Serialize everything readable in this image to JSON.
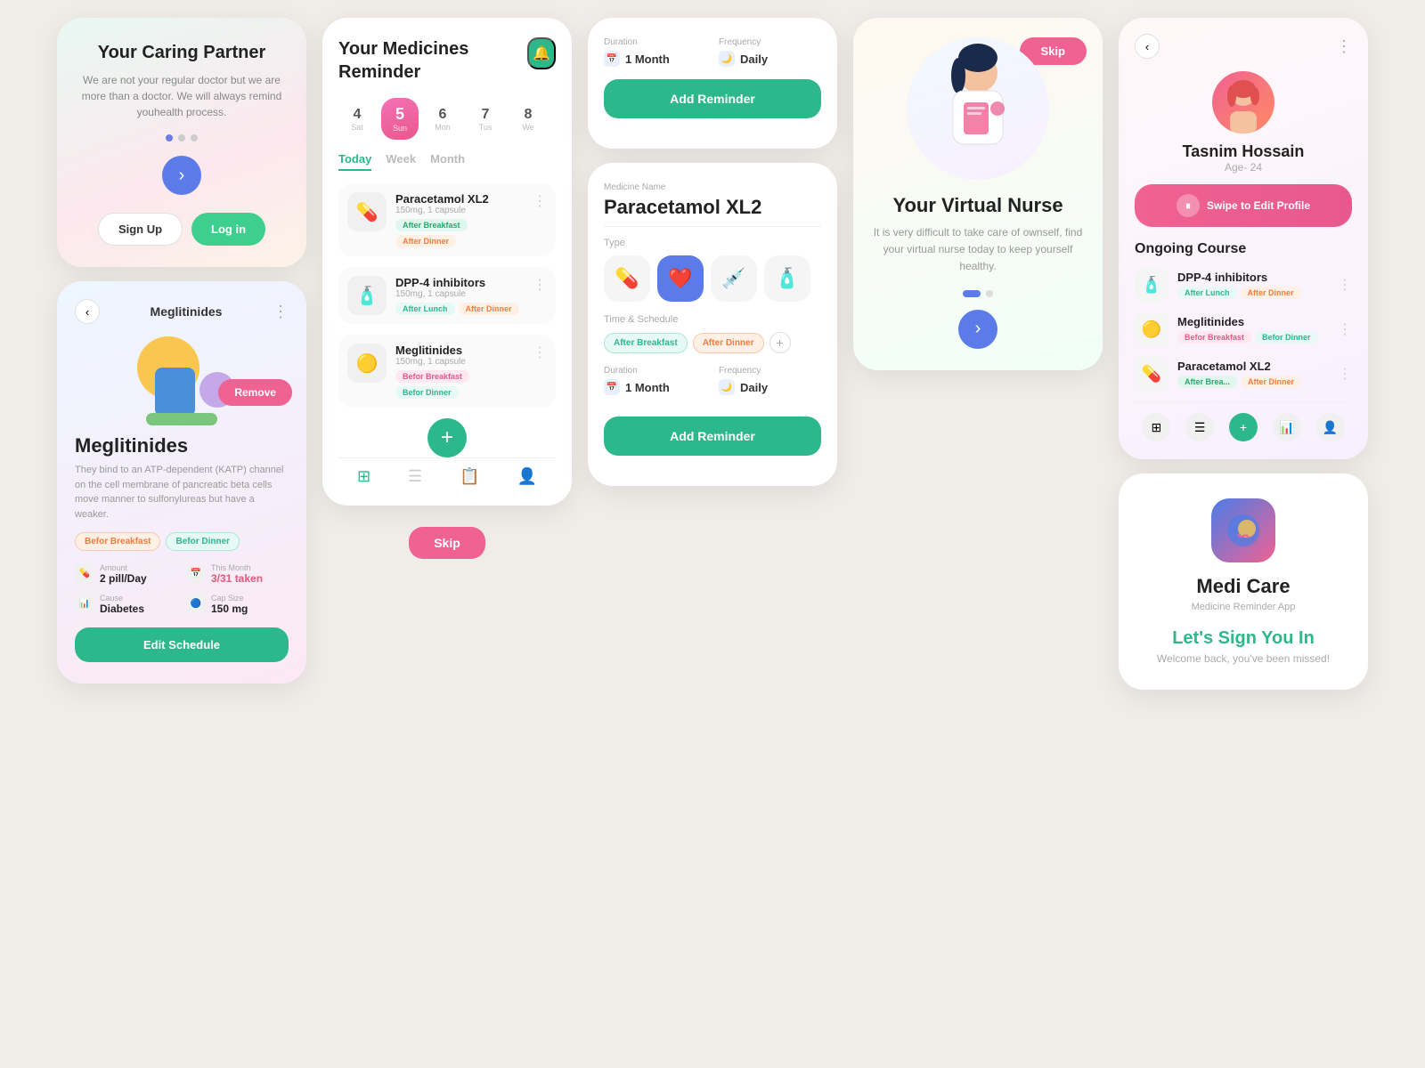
{
  "panel1": {
    "caring": {
      "title": "Your Caring Partner",
      "subtitle": "We are not your regular doctor but we are more than a doctor. We will always remind youhealth process.",
      "signup_label": "Sign Up",
      "login_label": "Log in"
    },
    "megli": {
      "back_label": "‹",
      "title": "Meglitinides",
      "more_label": "⋮",
      "remove_label": "Remove",
      "name": "Meglitinides",
      "desc": "They bind to an ATP-dependent (KATP) channel on the cell membrane of pancreatic beta cells move manner to sulfonylureas but have a weaker.",
      "tag1": "Befor Breakfast",
      "tag2": "Befor Dinner",
      "amount_label": "Amount",
      "amount_value": "2 pill/Day",
      "this_month_label": "This Month",
      "this_month_value": "3/31 taken",
      "cause_label": "Cause",
      "cause_value": "Diabetes",
      "cap_size_label": "Cap Size",
      "cap_size_value": "150 mg",
      "edit_label": "Edit Schedule"
    }
  },
  "panel2": {
    "reminder": {
      "title": "Your Medicines Reminder",
      "bell_icon": "🔔",
      "dates": [
        {
          "day": "4",
          "name": "Sat",
          "active": false
        },
        {
          "day": "5",
          "name": "Sun",
          "active": true
        },
        {
          "day": "6",
          "name": "Mon",
          "active": false
        },
        {
          "day": "7",
          "name": "Tus",
          "active": false
        },
        {
          "day": "8",
          "name": "We",
          "active": false
        }
      ],
      "tabs": [
        "Today",
        "Week",
        "Month"
      ],
      "active_tab": "Today",
      "medicines": [
        {
          "name": "Paracetamol XL2",
          "dose": "150mg, 1 capsule",
          "tags": [
            "After Breakfast",
            "After Dinner"
          ],
          "icon": "💊"
        },
        {
          "name": "DPP-4 inhibitors",
          "dose": "150mg, 1 capsule",
          "tags": [
            "After Lunch",
            "After Dinner"
          ],
          "icon": "🧴"
        },
        {
          "name": "Meglitinides",
          "dose": "150mg, 1 capsule",
          "tags": [
            "Befor Breakfast",
            "Befor Dinner"
          ],
          "icon": "🟡"
        }
      ],
      "skip_label": "Skip"
    }
  },
  "panel3": {
    "add_reminder": {
      "duration_label": "Duration",
      "duration_value": "1 Month",
      "frequency_label": "Frequency",
      "frequency_value": "Daily",
      "add_btn_label": "Add Reminder",
      "medicine_name_label": "Medicine Name",
      "medicine_name": "Paracetamol XL2",
      "type_label": "Type",
      "time_schedule_label": "Time & Schedule",
      "time_tags": [
        "After Breakfast",
        "After Dinner"
      ],
      "duration2_label": "Duration",
      "duration2_value": "1 Month",
      "frequency2_label": "Frequency",
      "frequency2_value": "Daily",
      "add_btn2_label": "Add Reminder"
    },
    "breakfast": {
      "label": "Breakfast"
    }
  },
  "panel4": {
    "virtual_nurse": {
      "skip_label": "Skip",
      "title": "Your Virtual Nurse",
      "subtitle": "It is very difficult to take care of ownself, find your virtual nurse today to keep yourself healthy."
    }
  },
  "panel5": {
    "profile": {
      "back_label": "‹",
      "more_label": "⋮",
      "name": "Tasnim Hossain",
      "age": "Age- 24",
      "swipe_label": "Swipe to Edit Profile",
      "ongoing_title": "Ongoing Course",
      "courses": [
        {
          "name": "DPP-4 inhibitors",
          "tags": [
            "After Lunch",
            "After Dinner"
          ],
          "icon": "🧴"
        },
        {
          "name": "Meglitinides",
          "tags": [
            "Befor Breakfast",
            "Befor Dinner"
          ],
          "icon": "🟡"
        },
        {
          "name": "Paracetamol XL2",
          "tags": [
            "After Brea...",
            "After Dinner"
          ],
          "icon": "💊"
        }
      ]
    },
    "signin": {
      "app_name": "Medi Care",
      "app_tagline": "Medicine Reminder App",
      "title": "Let's Sign You In",
      "subtitle": "Welcome back, you've been missed!"
    }
  }
}
